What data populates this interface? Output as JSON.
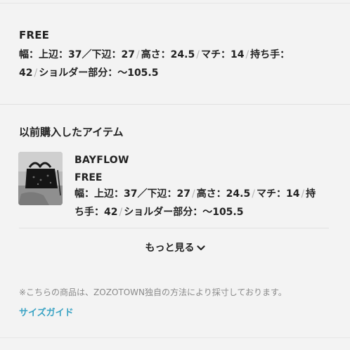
{
  "current_size": {
    "label": "FREE",
    "line1": {
      "width": "幅：上辺：37／下辺：27",
      "height": "高さ：24.5",
      "gusset": "マチ：14",
      "handle_prefix": "持ち手："
    },
    "line2": {
      "handle_value": "42",
      "shoulder": "ショルダー部分：〜105.5"
    },
    "separator": "/"
  },
  "history": {
    "title": "以前購入したアイテム",
    "item": {
      "brand": "BAYFLOW",
      "size": "FREE",
      "line1": {
        "width": "幅：上辺：37／下辺：27",
        "height": "高さ：24.5",
        "gusset": "マチ：14",
        "handle_prefix": "持"
      },
      "line2": {
        "handle_rest": "ち手：42",
        "shoulder": "ショルダー部分：〜105.5"
      }
    }
  },
  "more_button": {
    "label": "もっと見る",
    "icon": "chevron-down-icon"
  },
  "note": "※こちらの商品は、ZOZOTOWN独自の方法により採寸しております。",
  "size_guide": {
    "label": "サイズガイド",
    "color": "#3aa3c4"
  }
}
